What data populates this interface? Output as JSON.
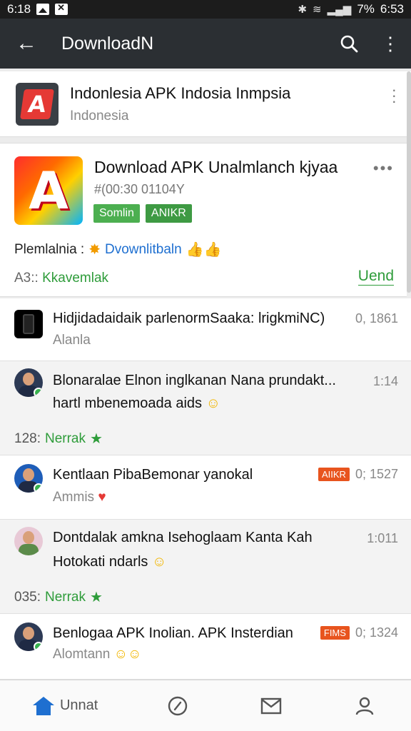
{
  "status_bar": {
    "time_left": "6:18",
    "battery": "7%",
    "time_right": "6:53"
  },
  "app_bar": {
    "title": "DownloadN",
    "back_icon": "arrow-left-icon",
    "search_icon": "search-icon",
    "more_icon": "more-vert-icon"
  },
  "header": {
    "title": "Indonlesia APK Indosia Inmpsia",
    "subtitle": "Indonesia"
  },
  "main_card": {
    "title": "Download APK Unalmlanch kjyaa",
    "id": "#(00:30 01104Y",
    "tags": [
      "Somlin",
      "ANIKR"
    ],
    "promo_label": "Plemlalnia :",
    "promo_link": "Dvownlitbaln",
    "foot_num": "A3::",
    "foot_text": "Kkavemlak",
    "foot_right": "Uend"
  },
  "rows": [
    {
      "title": "Hidjidadaidaik parlenormSaaka: lrigkmiNC)",
      "sub": "Alanla",
      "meta": "0, 1861"
    },
    {
      "title": "Blonaralae Elnon inglkanan Nana prundakt...",
      "sub2": "hartl mbenemoada aids",
      "meta": "1:14",
      "foot_num": "128:",
      "foot_text": "Nerrak"
    },
    {
      "title": "Kentlaan PibaBemonar yanokal",
      "sub": "Ammis",
      "badge": "AIIKR",
      "meta": "0; 1527"
    },
    {
      "title": "Dontdalak amkna Isehoglaam Kanta Kah",
      "sub2": "Hotokati ndarls",
      "meta": "1:011",
      "foot_num": "035:",
      "foot_text": "Nerrak"
    },
    {
      "title": "Benlogaa APK Inolian. APK Insterdian",
      "sub": "Alomtann",
      "badge": "FIMS",
      "meta": "0; 1324"
    }
  ],
  "bottom_nav": {
    "home_label": "Unnat"
  },
  "colors": {
    "app_bar": "#2b2f33",
    "accent_green": "#2e9c3a",
    "link_blue": "#1e6fd0",
    "badge_orange": "#e8541e"
  }
}
